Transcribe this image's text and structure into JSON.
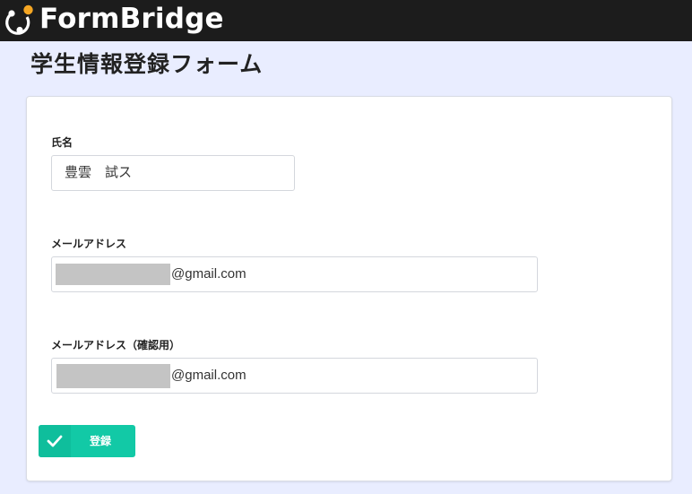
{
  "header": {
    "brand_name": "FormBridge",
    "logo_icon": "formbridge-logo-icon"
  },
  "page": {
    "title": "学生情報登録フォーム"
  },
  "form": {
    "fields": [
      {
        "label": "氏名",
        "value": "豊雲　試ス"
      },
      {
        "label": "メールアドレス",
        "value_suffix": "@gmail.com",
        "masked_prefix": true
      },
      {
        "label": "メールアドレス（確認用）",
        "value_suffix": "@gmail.com",
        "masked_prefix": true
      }
    ],
    "submit": {
      "label": "登録",
      "icon": "check-icon"
    }
  },
  "colors": {
    "topbar": "#1c1c1c",
    "background": "#e9edff",
    "accent": "#12c9a6",
    "logo_dot": "#f5a623"
  }
}
